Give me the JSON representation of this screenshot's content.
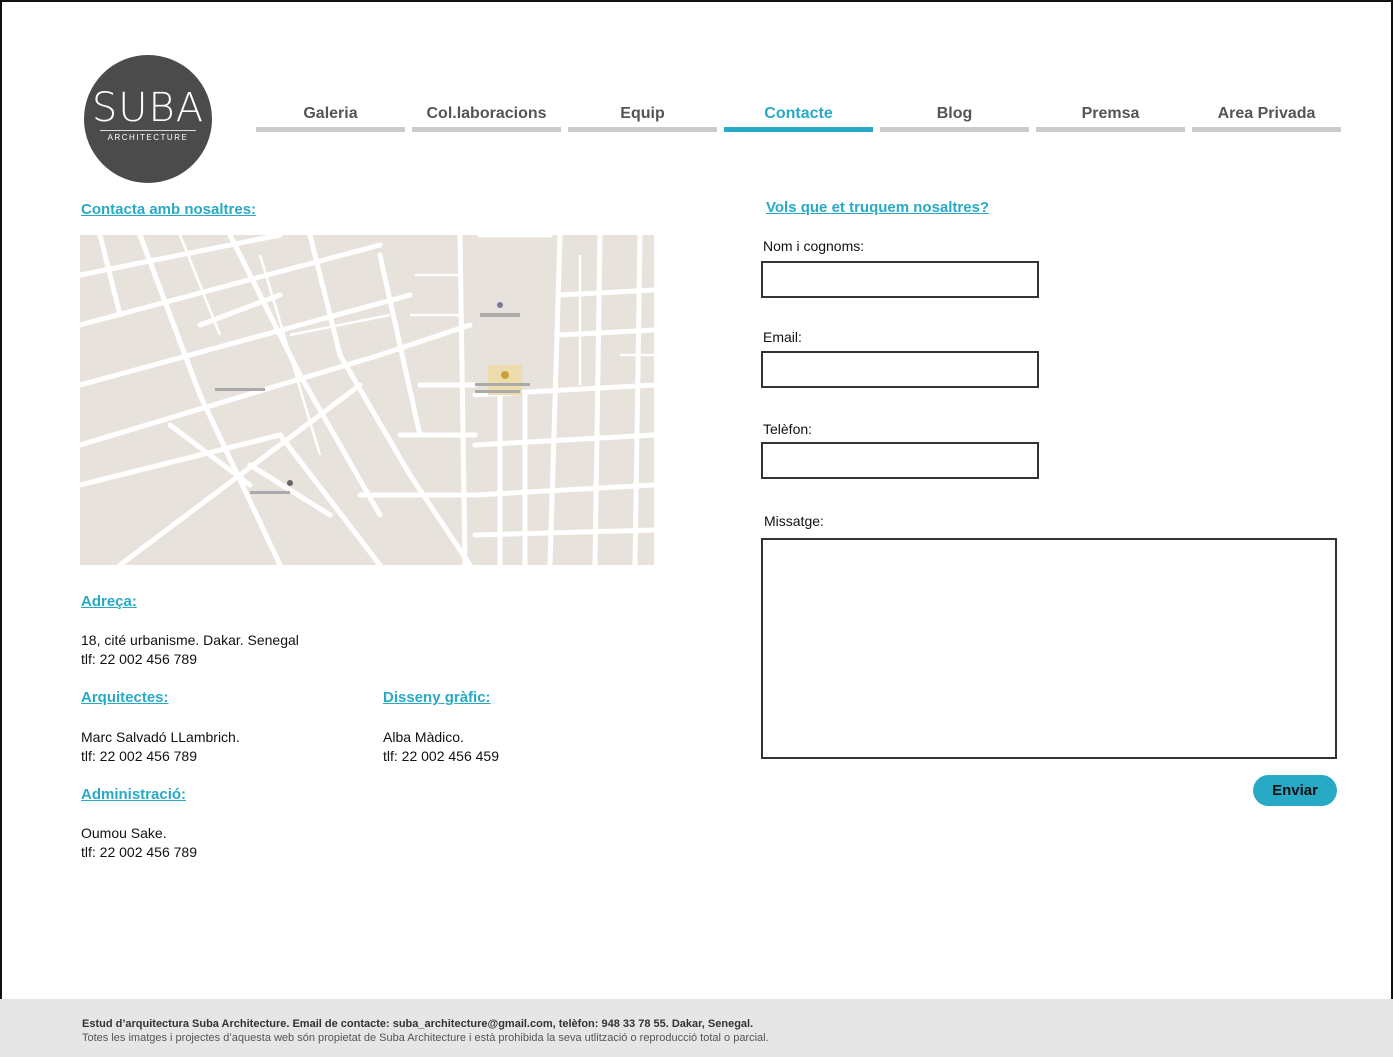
{
  "logo": {
    "main": "SUBA",
    "sub": "ARCHITECTURE"
  },
  "nav": {
    "items": [
      {
        "label": "Galeria"
      },
      {
        "label": "Col.laboracions"
      },
      {
        "label": "Equip"
      },
      {
        "label": "Contacte"
      },
      {
        "label": "Blog"
      },
      {
        "label": "Premsa"
      },
      {
        "label": "Area Privada"
      }
    ],
    "active": "Contacte"
  },
  "contact": {
    "heading": "Contacta amb nosaltres:",
    "address": {
      "heading": "Adreça:",
      "line1": "18, cité urbanisme. Dakar. Senegal",
      "line2": "tlf: 22 002 456 789"
    },
    "architects": {
      "heading": "Arquitectes:",
      "line1": "Marc Salvadó LLambrich.",
      "line2": "tlf: 22 002 456 789"
    },
    "design": {
      "heading": "Disseny gràfic:",
      "line1": "Alba Màdico.",
      "line2": "tlf: 22 002 456 459"
    },
    "admin": {
      "heading": "Administració:",
      "line1": "Oumou Sake.",
      "line2": "tlf: 22 002 456 789"
    }
  },
  "form": {
    "heading": "Vols que et truquem nosaltres?",
    "name_label": "Nom i cognoms:",
    "email_label": "Email:",
    "phone_label": "Telèfon:",
    "message_label": "Missatge:",
    "submit_label": "Enviar"
  },
  "footer": {
    "line1": "Estud d’arquitectura Suba Architecture. Email de contacte: suba_architecture@gmail.com, telèfon: 948 33 78 55. Dakar, Senegal.",
    "line2": "Totes les imatges i projectes d’aquesta web són propietat de Suba Architecture i està prohibida la seva utlització o reproducció total o parcial."
  },
  "colors": {
    "accent": "#28aac6",
    "logo_bg": "#4b4b4b",
    "footer_bg": "#e6e6e6",
    "map_bg": "#e7e3dc"
  }
}
